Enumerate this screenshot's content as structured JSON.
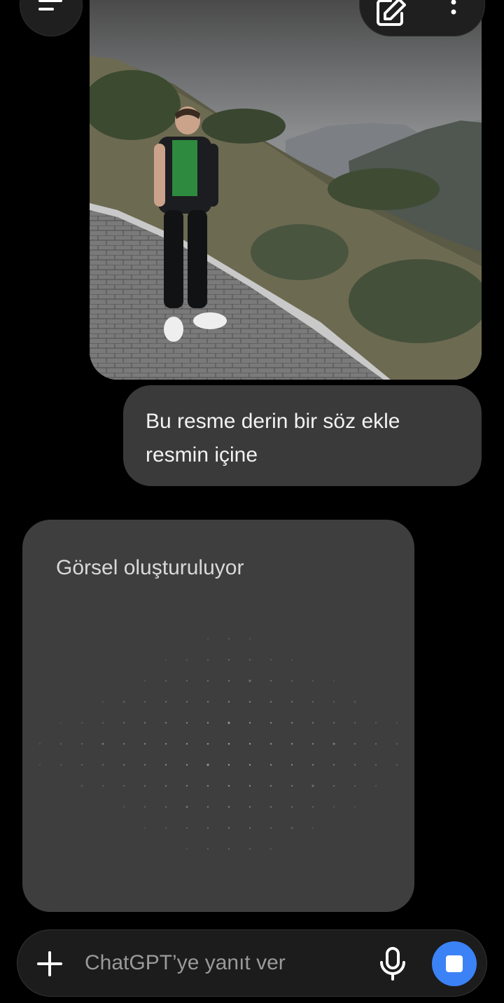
{
  "header": {
    "menu_icon": "menu-icon",
    "new_chat_icon": "edit-icon",
    "more_icon": "more-vertical-icon"
  },
  "conversation": {
    "user_image": {
      "icon": "photo-image"
    },
    "user_message": "Bu resme derin bir söz ekle resmin içine",
    "assistant_status": "Görsel oluşturuluyor"
  },
  "composer": {
    "placeholder": "ChatGPT’ye yanıt ver",
    "add_icon": "plus-icon",
    "mic_icon": "mic-icon",
    "stop_icon": "stop-icon",
    "accent_color": "#3b82f6"
  }
}
